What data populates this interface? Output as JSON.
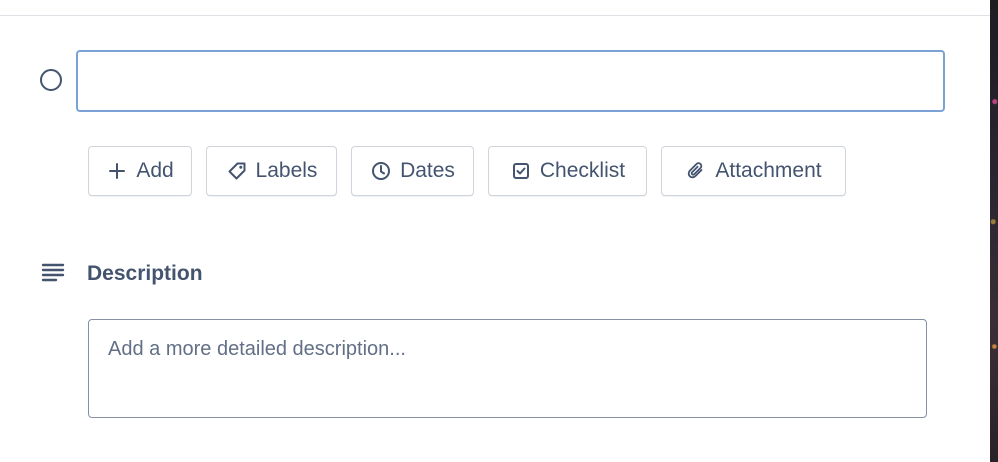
{
  "card": {
    "title_value": "",
    "complete_toggle_icon": "circle-outline-icon"
  },
  "actions": [
    {
      "icon": "plus-icon",
      "label": "Add"
    },
    {
      "icon": "tag-icon",
      "label": "Labels"
    },
    {
      "icon": "clock-icon",
      "label": "Dates"
    },
    {
      "icon": "checkbox-icon",
      "label": "Checklist"
    },
    {
      "icon": "paperclip-icon",
      "label": "Attachment"
    }
  ],
  "description": {
    "icon": "text-lines-icon",
    "heading": "Description",
    "placeholder": "Add a more detailed description..."
  },
  "colors": {
    "focus_border": "#7aa2d6",
    "button_border": "#d0d4db",
    "text_muted": "#44546f"
  }
}
